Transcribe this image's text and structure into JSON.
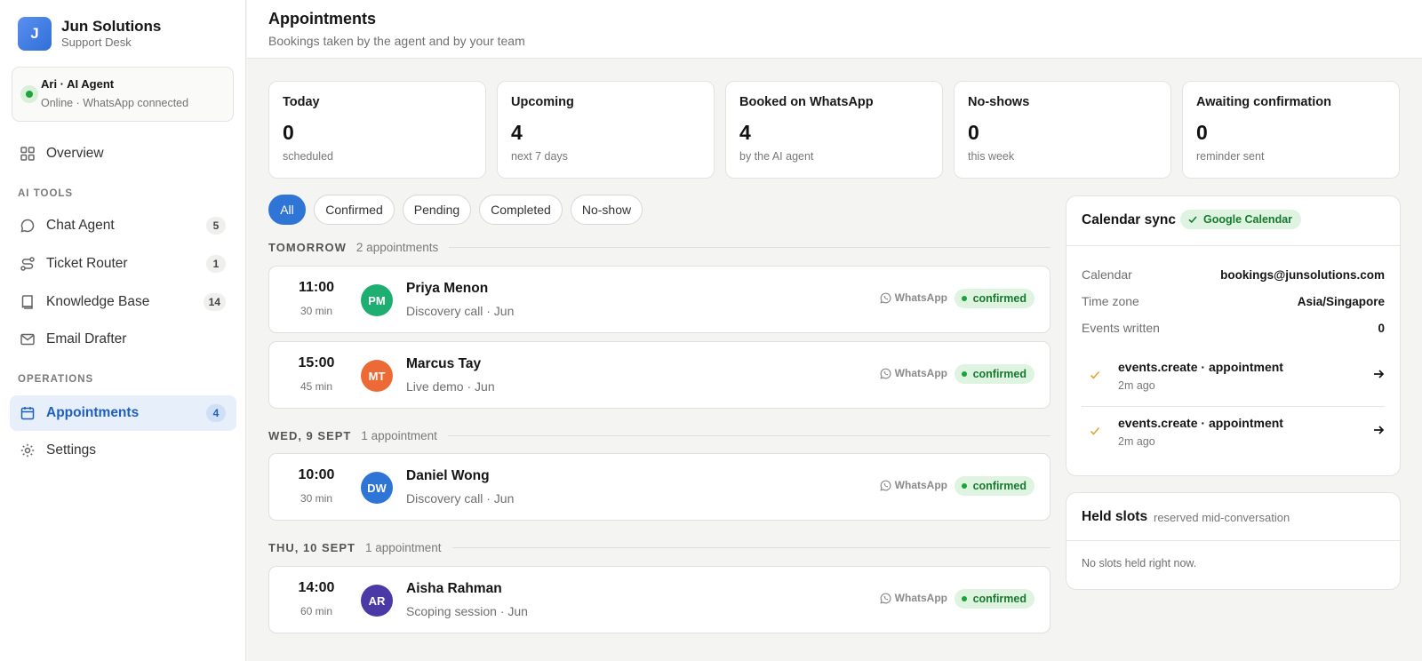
{
  "brand": {
    "initial": "J",
    "name": "Jun Solutions",
    "subtitle": "Support Desk"
  },
  "agent": {
    "name": "Ari · AI Agent",
    "status": "Online · WhatsApp connected"
  },
  "sidebar": {
    "overview": {
      "label": "Overview",
      "icon": "grid-icon"
    },
    "ai_tools_label": "AI TOOLS",
    "ai_tools": [
      {
        "label": "Chat Agent",
        "count": "5",
        "icon": "chat-icon"
      },
      {
        "label": "Ticket Router",
        "count": "1",
        "icon": "route-icon"
      },
      {
        "label": "Knowledge Base",
        "count": "14",
        "icon": "book-icon"
      },
      {
        "label": "Email Drafter",
        "count": "",
        "icon": "mail-icon"
      }
    ],
    "operations_label": "OPERATIONS",
    "operations": [
      {
        "label": "Appointments",
        "count": "4",
        "icon": "calendar-icon",
        "active": true
      },
      {
        "label": "Settings",
        "count": "",
        "icon": "gear-icon"
      }
    ]
  },
  "header": {
    "title": "Appointments",
    "subtitle": "Bookings taken by the agent and by your team"
  },
  "stats": [
    {
      "label": "Today",
      "value": "0",
      "sub": "scheduled"
    },
    {
      "label": "Upcoming",
      "value": "4",
      "sub": "next 7 days"
    },
    {
      "label": "Booked on WhatsApp",
      "value": "4",
      "sub": "by the AI agent"
    },
    {
      "label": "No-shows",
      "value": "0",
      "sub": "this week"
    },
    {
      "label": "Awaiting confirmation",
      "value": "0",
      "sub": "reminder sent"
    }
  ],
  "filters": [
    "All",
    "Confirmed",
    "Pending",
    "Completed",
    "No-show"
  ],
  "groups": [
    {
      "title": "TOMORROW",
      "count": "2 appointments"
    },
    {
      "title": "WED, 9 SEPT",
      "count": "1 appointment"
    },
    {
      "title": "THU, 10 SEPT",
      "count": "1 appointment"
    }
  ],
  "appointments": [
    {
      "time": "11:00",
      "duration": "30 min",
      "initials": "PM",
      "avatar_color": "#1fae72",
      "name": "Priya Menon",
      "desc": "Discovery call · Jun",
      "channel": "WhatsApp",
      "status": "confirmed"
    },
    {
      "time": "15:00",
      "duration": "45 min",
      "initials": "MT",
      "avatar_color": "#ec6a36",
      "name": "Marcus Tay",
      "desc": "Live demo · Jun",
      "channel": "WhatsApp",
      "status": "confirmed"
    },
    {
      "time": "10:00",
      "duration": "30 min",
      "initials": "DW",
      "avatar_color": "#2f75d6",
      "name": "Daniel Wong",
      "desc": "Discovery call · Jun",
      "channel": "WhatsApp",
      "status": "confirmed"
    },
    {
      "time": "14:00",
      "duration": "60 min",
      "initials": "AR",
      "avatar_color": "#4b3aa6",
      "name": "Aisha Rahman",
      "desc": "Scoping session · Jun",
      "channel": "WhatsApp",
      "status": "confirmed"
    }
  ],
  "calendar": {
    "title": "Calendar sync",
    "provider": "Google Calendar",
    "rows": [
      {
        "key": "Calendar",
        "value": "bookings@junsolutions.com"
      },
      {
        "key": "Time zone",
        "value": "Asia/Singapore"
      },
      {
        "key": "Events written",
        "value": "0"
      }
    ],
    "events": [
      {
        "title": "events.create · appointment",
        "time": "2m ago"
      },
      {
        "title": "events.create · appointment",
        "time": "2m ago"
      }
    ]
  },
  "held": {
    "title": "Held slots",
    "subtitle": "reserved mid-conversation",
    "empty": "No slots held right now."
  }
}
